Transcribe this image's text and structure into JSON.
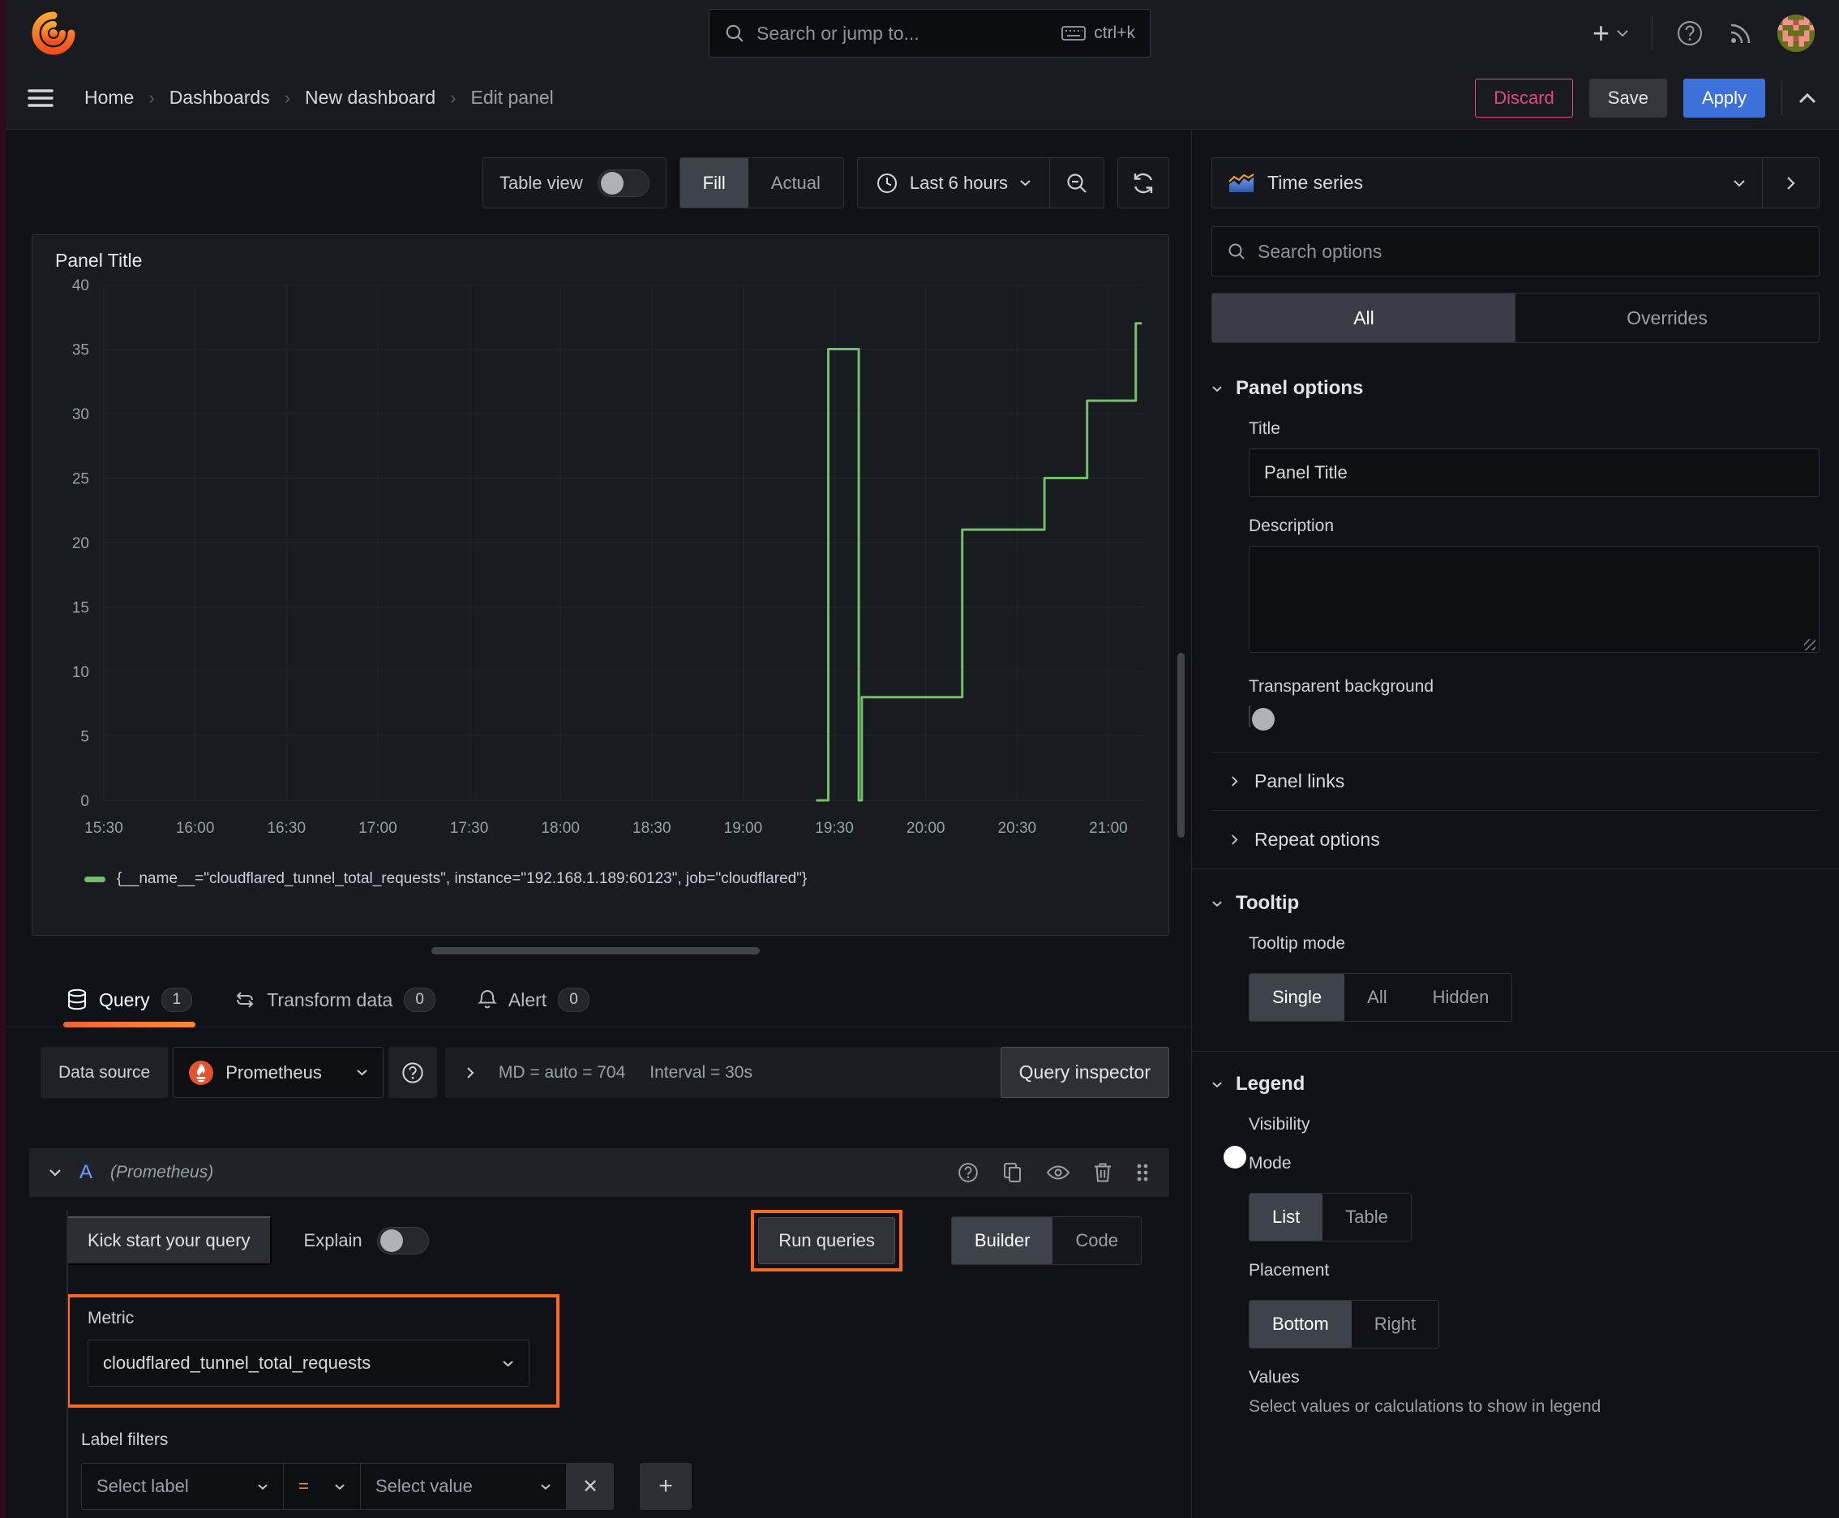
{
  "topbar": {
    "search_placeholder": "Search or jump to...",
    "shortcut": "ctrl+k",
    "add_label": "+"
  },
  "breadcrumb": {
    "items": [
      "Home",
      "Dashboards",
      "New dashboard",
      "Edit panel"
    ]
  },
  "header_actions": {
    "discard": "Discard",
    "save": "Save",
    "apply": "Apply"
  },
  "view_toolbar": {
    "table_view": "Table view",
    "fill": "Fill",
    "actual": "Actual",
    "time_range": "Last 6 hours"
  },
  "panel": {
    "title": "Panel Title"
  },
  "chart_data": {
    "type": "line",
    "step": true,
    "title": "Panel Title",
    "grid": true,
    "legend_position": "bottom",
    "x_axis": {
      "tick_interval_minutes": 30,
      "tick_labels": [
        "15:30",
        "16:00",
        "16:30",
        "17:00",
        "17:30",
        "18:00",
        "18:30",
        "19:00",
        "19:30",
        "20:00",
        "20:30",
        "21:00"
      ],
      "range_minutes": [
        0,
        342
      ]
    },
    "y_axis": {
      "min": 0,
      "max": 40,
      "tick_step": 5,
      "tick_labels": [
        "0",
        "5",
        "10",
        "15",
        "20",
        "25",
        "30",
        "35",
        "40"
      ]
    },
    "series": [
      {
        "name": "{__name__=\"cloudflared_tunnel_total_requests\", instance=\"192.168.1.189:60123\", job=\"cloudflared\"}",
        "color": "#73bf69",
        "points_minutes_value": [
          [
            234,
            0
          ],
          [
            238,
            0
          ],
          [
            238,
            35
          ],
          [
            248,
            35
          ],
          [
            248,
            0
          ],
          [
            249,
            0
          ],
          [
            249,
            8
          ],
          [
            282,
            8
          ],
          [
            282,
            21
          ],
          [
            309,
            21
          ],
          [
            309,
            25
          ],
          [
            323,
            25
          ],
          [
            323,
            31
          ],
          [
            339,
            31
          ],
          [
            339,
            37
          ],
          [
            341,
            37
          ]
        ]
      }
    ]
  },
  "query_tabs": [
    {
      "label": "Query",
      "badge": "1"
    },
    {
      "label": "Transform data",
      "badge": "0"
    },
    {
      "label": "Alert",
      "badge": "0"
    }
  ],
  "datasource_row": {
    "label": "Data source",
    "name": "Prometheus",
    "metadata": "MD = auto = 704",
    "interval": "Interval = 30s",
    "inspector": "Query inspector"
  },
  "query_editor": {
    "ref_id": "A",
    "ds_hint": "(Prometheus)",
    "kickstart": "Kick start your query",
    "explain": "Explain",
    "run": "Run queries",
    "builder": "Builder",
    "code": "Code",
    "metric_label": "Metric",
    "metric_value": "cloudflared_tunnel_total_requests",
    "label_filters_label": "Label filters",
    "select_label": "Select label",
    "operator": "=",
    "select_value": "Select value",
    "remove_label": "✕",
    "add_label": "+"
  },
  "options_pane": {
    "visualization": "Time series",
    "search_placeholder": "Search options",
    "filter_tabs": {
      "all": "All",
      "overrides": "Overrides"
    },
    "panel_options": {
      "header": "Panel options",
      "title_label": "Title",
      "title_value": "Panel Title",
      "description_label": "Description",
      "transparent_label": "Transparent background"
    },
    "links_label": "Panel links",
    "repeat_label": "Repeat options",
    "tooltip": {
      "header": "Tooltip",
      "mode_label": "Tooltip mode",
      "options": [
        "Single",
        "All",
        "Hidden"
      ],
      "selected": "Single"
    },
    "legend": {
      "header": "Legend",
      "visibility_label": "Visibility",
      "mode_label": "Mode",
      "mode_options": [
        "List",
        "Table"
      ],
      "selected_mode": "List",
      "placement_label": "Placement",
      "placement_options": [
        "Bottom",
        "Right"
      ],
      "selected_placement": "Bottom",
      "values_label": "Values",
      "values_hint": "Select values or calculations to show in legend"
    }
  },
  "toggle_states": {
    "table_view": false,
    "explain": false,
    "transparent_background": false,
    "legend_visibility": true
  },
  "colors": {
    "accent_blue": "#3d71d9",
    "highlight_orange": "#ff671d",
    "series_green": "#73bf69",
    "discard_pink": "#e5487e",
    "prometheus_orange": "#e6522c",
    "tab_underline": "#ff8833"
  },
  "icons": {
    "search": "magnifier",
    "keyboard": "keyboard",
    "add": "plus",
    "help": "question-circle",
    "news": "rss-signal",
    "menu": "hamburger",
    "clock": "clock",
    "zoom_out": "magnifier-minus",
    "refresh": "circular-arrow",
    "query": "database-cylinder",
    "transform": "rotate-arrows",
    "alert": "bell",
    "duplicate": "copy",
    "hide": "eye",
    "delete": "trash",
    "drag": "grip-dots"
  }
}
